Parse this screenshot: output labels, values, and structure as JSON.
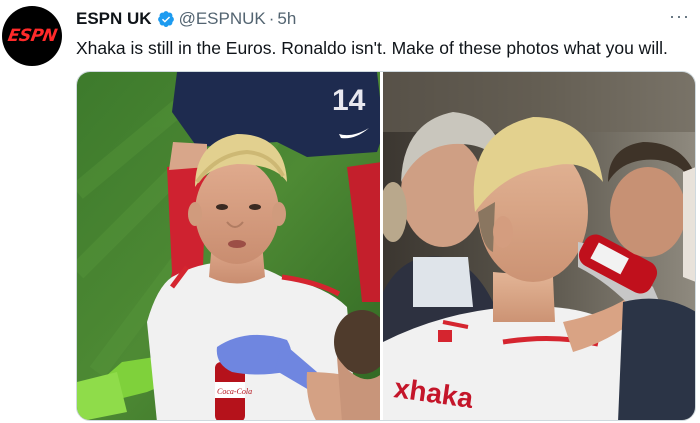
{
  "tweet": {
    "display_name": "ESPN UK",
    "handle": "@ESPNUK",
    "separator": "·",
    "time": "5h",
    "text": "Xhaka is still in the Euros. Ronaldo isn't. Make of these photos what you will.",
    "more_label": "···"
  },
  "avatar": {
    "logo_text": "ESPN"
  },
  "photos": {
    "left": {
      "shirt_number": "14",
      "bottle_brand": "Coca-Cola"
    },
    "right": {
      "shirt_name": "xhaka"
    }
  },
  "colors": {
    "verified": "#1d9bf0",
    "brand_red": "#ff2a2a",
    "secondary_text": "#536471",
    "border": "#cfd9de"
  },
  "icons": [
    "verified-badge-icon",
    "more-options-icon"
  ]
}
